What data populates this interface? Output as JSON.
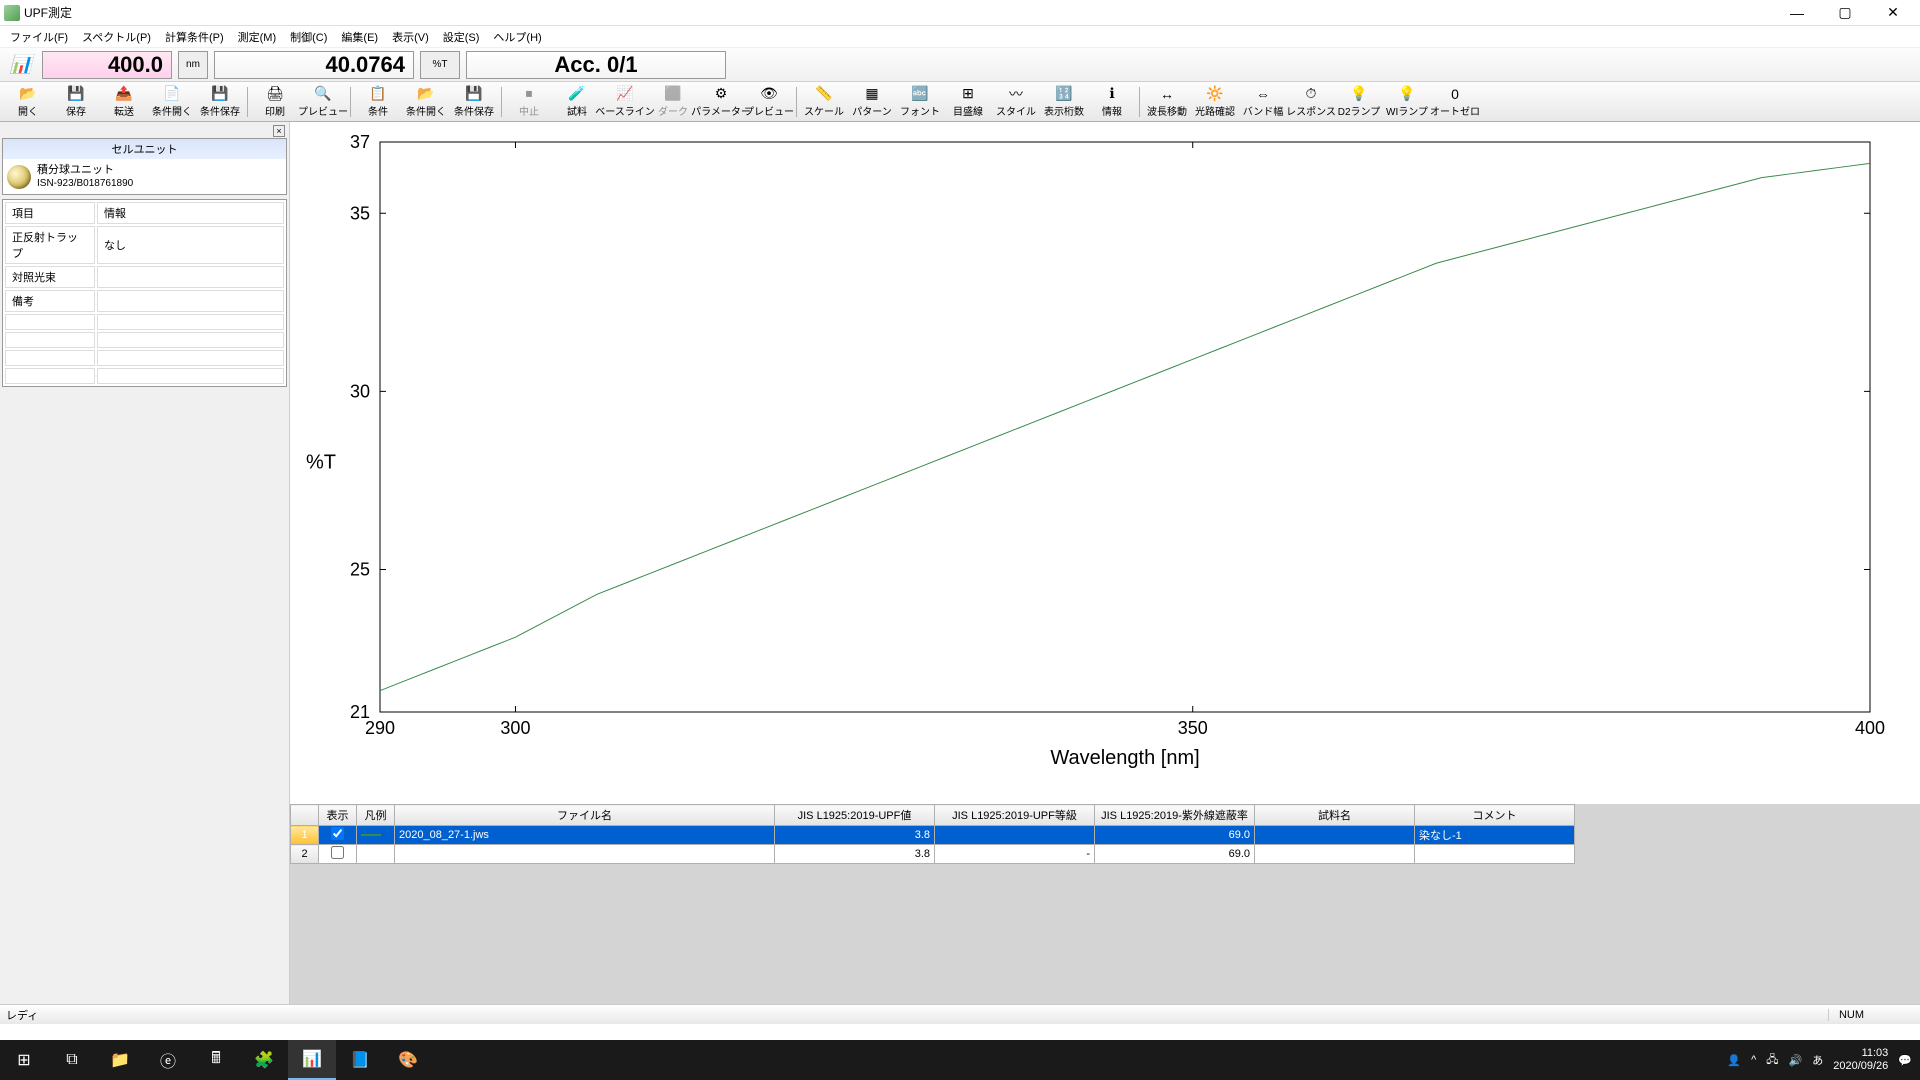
{
  "window": {
    "title": "UPF測定"
  },
  "menu": [
    "ファイル(F)",
    "スペクトル(P)",
    "計算条件(P)",
    "測定(M)",
    "制御(C)",
    "編集(E)",
    "表示(V)",
    "設定(S)",
    "ヘルプ(H)"
  ],
  "display": {
    "wavelength": "400.0",
    "wl_unit": "nm",
    "value": "40.0764",
    "val_unit": "%T",
    "acc": "Acc. 0/1"
  },
  "toolbar": [
    {
      "l": "開く",
      "i": "📂"
    },
    {
      "l": "保存",
      "i": "💾"
    },
    {
      "l": "転送",
      "i": "📤"
    },
    {
      "l": "条件開く",
      "i": "📄"
    },
    {
      "l": "条件保存",
      "i": "💾"
    },
    {
      "sep": true
    },
    {
      "l": "印刷",
      "i": "🖨"
    },
    {
      "l": "プレビュー",
      "i": "🔍"
    },
    {
      "sep": true
    },
    {
      "l": "条件",
      "i": "📋"
    },
    {
      "l": "条件開く",
      "i": "📂"
    },
    {
      "l": "条件保存",
      "i": "💾"
    },
    {
      "sep": true
    },
    {
      "l": "中止",
      "i": "⏹",
      "d": true
    },
    {
      "l": "試料",
      "i": "🧪"
    },
    {
      "l": "ベースライン",
      "i": "📈"
    },
    {
      "l": "ダーク",
      "i": "⬛",
      "d": true
    },
    {
      "l": "パラメーター",
      "i": "⚙"
    },
    {
      "l": "プレビュー",
      "i": "👁"
    },
    {
      "sep": true
    },
    {
      "l": "スケール",
      "i": "📏"
    },
    {
      "l": "パターン",
      "i": "▦"
    },
    {
      "l": "フォント",
      "i": "🔤"
    },
    {
      "l": "目盛線",
      "i": "⊞"
    },
    {
      "l": "スタイル",
      "i": "〰"
    },
    {
      "l": "表示桁数",
      "i": "🔢"
    },
    {
      "l": "情報",
      "i": "ℹ"
    },
    {
      "sep": true
    },
    {
      "l": "波長移動",
      "i": "↔"
    },
    {
      "l": "光路確認",
      "i": "🔆"
    },
    {
      "l": "バンド幅",
      "i": "⇔"
    },
    {
      "l": "レスポンス",
      "i": "⏱"
    },
    {
      "l": "D2ランプ",
      "i": "💡"
    },
    {
      "l": "WIランプ",
      "i": "💡"
    },
    {
      "l": "オートゼロ",
      "i": "0"
    }
  ],
  "sidebar": {
    "cell_title": "セルユニット",
    "cell_name": "積分球ユニット",
    "cell_id": "ISN-923/B018761890",
    "props": [
      [
        "項目",
        "情報"
      ],
      [
        "正反射トラップ",
        "なし"
      ],
      [
        "対照光束",
        ""
      ],
      [
        "備考",
        ""
      ]
    ]
  },
  "chart_data": {
    "type": "line",
    "title": "",
    "xlabel": "Wavelength [nm]",
    "ylabel": "%T",
    "xlim": [
      290,
      400
    ],
    "ylim": [
      21,
      37
    ],
    "xticks": [
      300,
      350,
      400
    ],
    "yticks": [
      21,
      25,
      30,
      35,
      37
    ],
    "x": [
      290,
      292,
      294,
      296,
      298,
      300,
      302,
      304,
      306,
      308,
      310,
      312,
      314,
      316,
      318,
      320,
      322,
      324,
      326,
      328,
      330,
      332,
      334,
      336,
      338,
      340,
      342,
      344,
      346,
      348,
      350,
      352,
      354,
      356,
      358,
      360,
      362,
      364,
      366,
      368,
      370,
      372,
      374,
      376,
      378,
      380,
      382,
      384,
      386,
      388,
      390,
      392,
      394,
      396,
      398,
      400
    ],
    "y": [
      21.6,
      21.9,
      22.2,
      22.5,
      22.8,
      23.1,
      23.5,
      23.9,
      24.3,
      24.6,
      24.9,
      25.2,
      25.5,
      25.8,
      26.1,
      26.4,
      26.7,
      27.0,
      27.3,
      27.6,
      27.9,
      28.2,
      28.5,
      28.8,
      29.1,
      29.4,
      29.7,
      30.0,
      30.3,
      30.6,
      30.9,
      31.2,
      31.5,
      31.8,
      32.1,
      32.4,
      32.7,
      33.0,
      33.3,
      33.6,
      33.8,
      34.0,
      34.2,
      34.4,
      34.6,
      34.8,
      35.0,
      35.2,
      35.4,
      35.6,
      35.8,
      36.0,
      36.1,
      36.2,
      36.3,
      36.4
    ]
  },
  "table": {
    "headers": [
      "",
      "表示",
      "凡例",
      "ファイル名",
      "JIS L1925:2019-UPF値",
      "JIS L1925:2019-UPF等級",
      "JIS L1925:2019-紫外線遮蔽率",
      "試料名",
      "コメント"
    ],
    "rows": [
      {
        "n": "1",
        "show": true,
        "file": "2020_08_27-1.jws",
        "upf": "3.8",
        "grade": "",
        "shield": "69.0",
        "sample": "",
        "comment": "染なし-1",
        "sel": true
      },
      {
        "n": "2",
        "show": false,
        "file": "",
        "upf": "3.8",
        "grade": "-",
        "shield": "69.0",
        "sample": "",
        "comment": "",
        "sel": false
      }
    ]
  },
  "status": {
    "left": "レディ",
    "num": "NUM"
  },
  "taskbar": {
    "time": "11:03",
    "date": "2020/09/26",
    "ime": "あ"
  }
}
